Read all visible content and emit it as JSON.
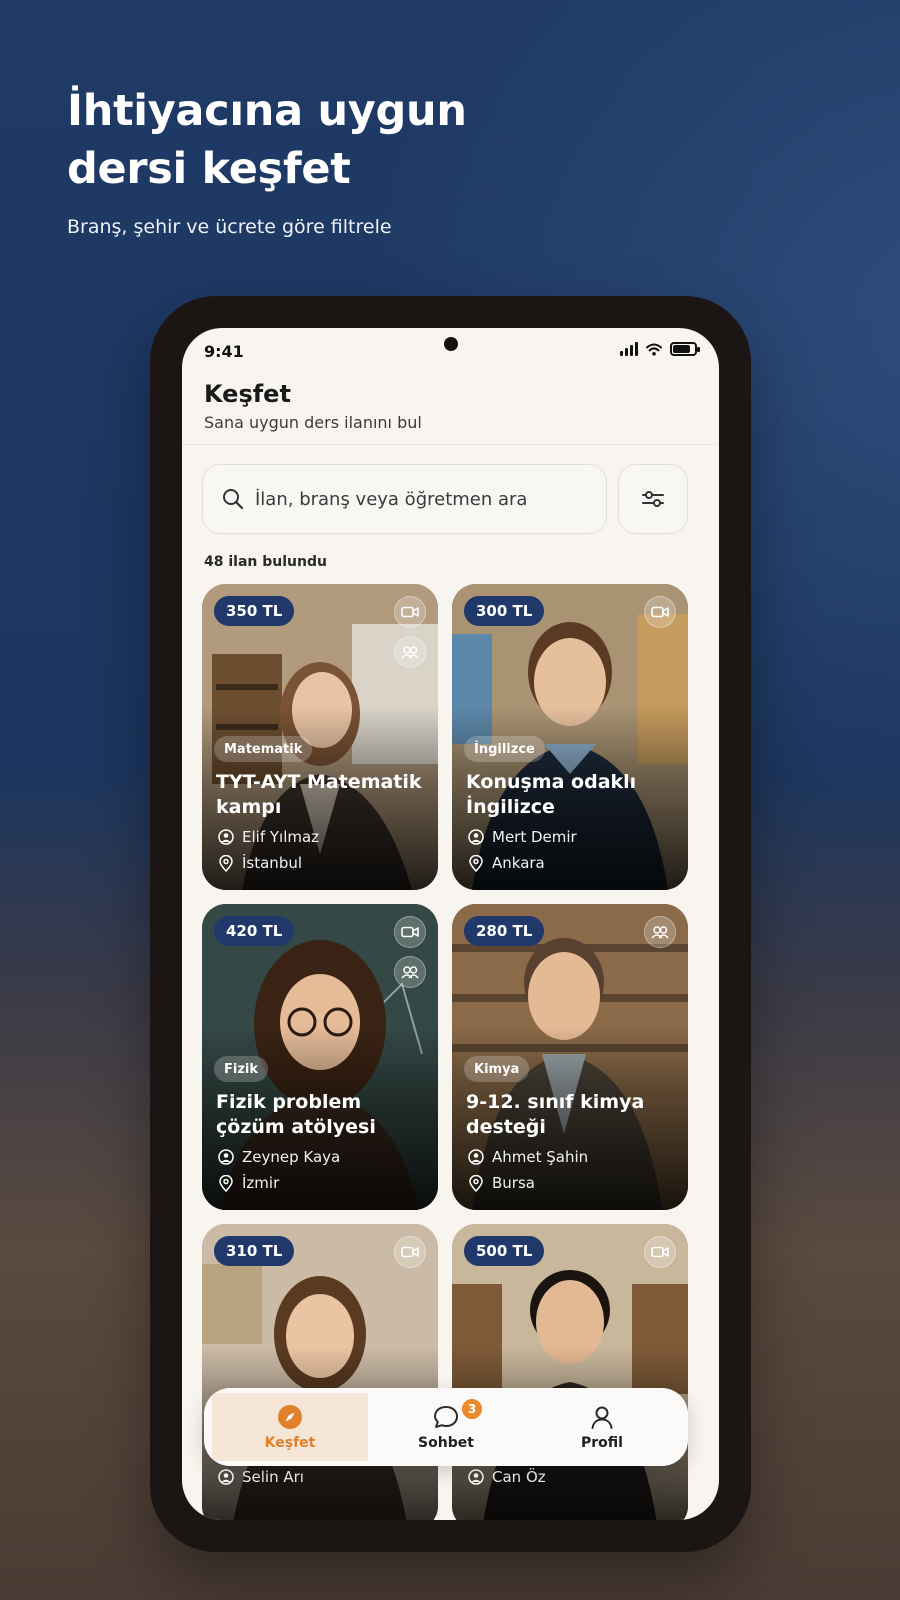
{
  "promo": {
    "headline_line1": "İhtiyacına uygun",
    "headline_line2": "dersi keşfet",
    "subtitle": "Branş, şehir ve ücrete göre filtrele"
  },
  "status_bar": {
    "time": "9:41"
  },
  "header": {
    "title": "Keşfet",
    "subtitle": "Sana uygun ders ilanını bul"
  },
  "search": {
    "placeholder": "İlan, branş veya öğretmen ara"
  },
  "results": {
    "count_text": "48 ilan bulundu"
  },
  "listings": [
    {
      "price": "350 TL",
      "branch": "Matematik",
      "title": "TYT-AYT Matematik kampı",
      "teacher": "Elif Yılmaz",
      "city": "İstanbul",
      "modes": [
        "video-icon",
        "group-icon"
      ]
    },
    {
      "price": "300 TL",
      "branch": "İngilizce",
      "title": "Konuşma odaklı İngilizce",
      "teacher": "Mert Demir",
      "city": "Ankara",
      "modes": [
        "video-icon"
      ]
    },
    {
      "price": "420 TL",
      "branch": "Fizik",
      "title": "Fizik problem çözüm atölyesi",
      "teacher": "Zeynep Kaya",
      "city": "İzmir",
      "modes": [
        "video-icon",
        "group-icon"
      ]
    },
    {
      "price": "280 TL",
      "branch": "Kimya",
      "title": "9-12. sınıf kimya desteği",
      "teacher": "Ahmet Şahin",
      "city": "Bursa",
      "modes": [
        "group-icon"
      ]
    },
    {
      "price": "310 TL",
      "teacher": "Selin Arı",
      "modes": [
        "video-icon"
      ]
    },
    {
      "price": "500 TL",
      "teacher": "Can Öz",
      "modes": [
        "video-icon"
      ]
    }
  ],
  "bottom_nav": {
    "items": [
      {
        "label": "Keşfet",
        "icon": "compass-icon",
        "active": true
      },
      {
        "label": "Sohbet",
        "icon": "chat-icon",
        "badge": "3"
      },
      {
        "label": "Profil",
        "icon": "user-icon"
      }
    ]
  },
  "colors": {
    "price_badge": "#20396a",
    "accent_orange": "#e0802a",
    "screen_bg": "#f8f5f1"
  }
}
